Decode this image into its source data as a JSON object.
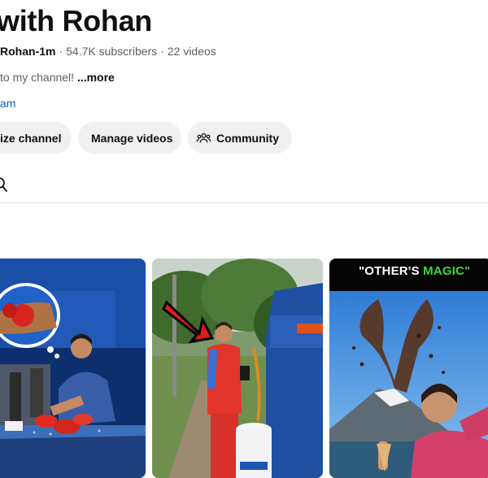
{
  "channel": {
    "title": "with Rohan",
    "handle": "Rohan-1m",
    "subscribers": "54.7K subscribers",
    "videos": "22 videos",
    "description": "to my channel! ",
    "more_label": "...more",
    "link_text": "am"
  },
  "buttons": {
    "customize": "ize channel",
    "manage": "Manage videos",
    "community": "Community"
  },
  "videos": [
    {
      "thumbnail": "boxer-gloves-table"
    },
    {
      "thumbnail": "man-garbage-truck-arrow"
    },
    {
      "thumbnail": "volcano-magic",
      "caption_part1": "\"OTHER'S ",
      "caption_part2": "MAGIC\""
    }
  ],
  "colors": {
    "link": "#065fd4",
    "button_bg": "#f0f0f0",
    "caption_accent": "#3ddc2f"
  }
}
